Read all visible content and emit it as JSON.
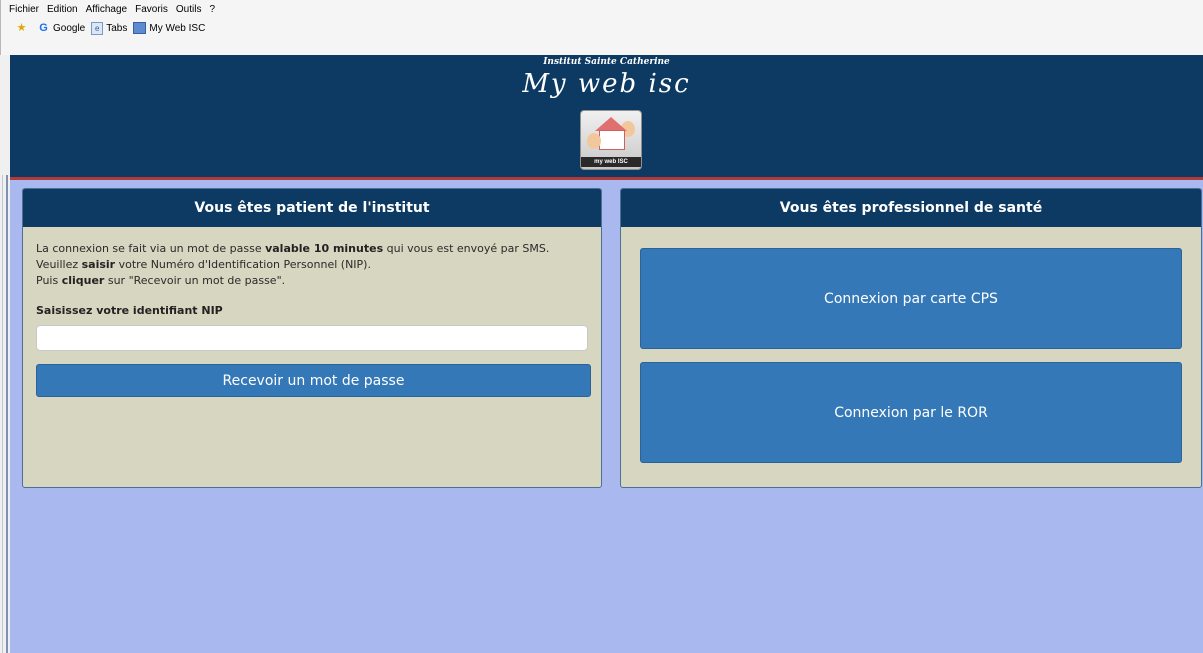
{
  "browser": {
    "menu": [
      "Fichier",
      "Edition",
      "Affichage",
      "Favoris",
      "Outils",
      "?"
    ],
    "favorites": [
      {
        "label": "Google",
        "icon": "google-icon"
      },
      {
        "label": "Tabs",
        "icon": "tabs-icon"
      },
      {
        "label": "My Web ISC",
        "icon": "web-page-icon"
      }
    ]
  },
  "header": {
    "institute": "Institut Sainte Catherine",
    "title": "My web isc",
    "logo_caption": "my web ISC",
    "background": "#0d3a63",
    "border_color": "#b03a3a"
  },
  "patient": {
    "title": "Vous êtes patient de l'institut",
    "line1_pre": "La connexion se fait via un mot de passe ",
    "line1_bold": "valable 10 minutes",
    "line1_post": " qui vous est envoyé par SMS.",
    "line2_pre": "Veuillez ",
    "line2_bold": "saisir",
    "line2_post": " votre Numéro d'Identification Personnel (NIP).",
    "line3_pre": "Puis ",
    "line3_bold": "cliquer",
    "line3_post": " sur \"Recevoir un mot de passe\".",
    "nip_label": "Saisissez votre identifiant NIP",
    "nip_value": "",
    "button": "Recevoir un mot de passe"
  },
  "professional": {
    "title": "Vous êtes professionnel de santé",
    "cps_button": "Connexion par carte CPS",
    "ror_button": "Connexion par le ROR"
  },
  "colors": {
    "page_background": "#a9b9f0",
    "panel_background": "#d7d6c0",
    "button": "#3578b7"
  }
}
